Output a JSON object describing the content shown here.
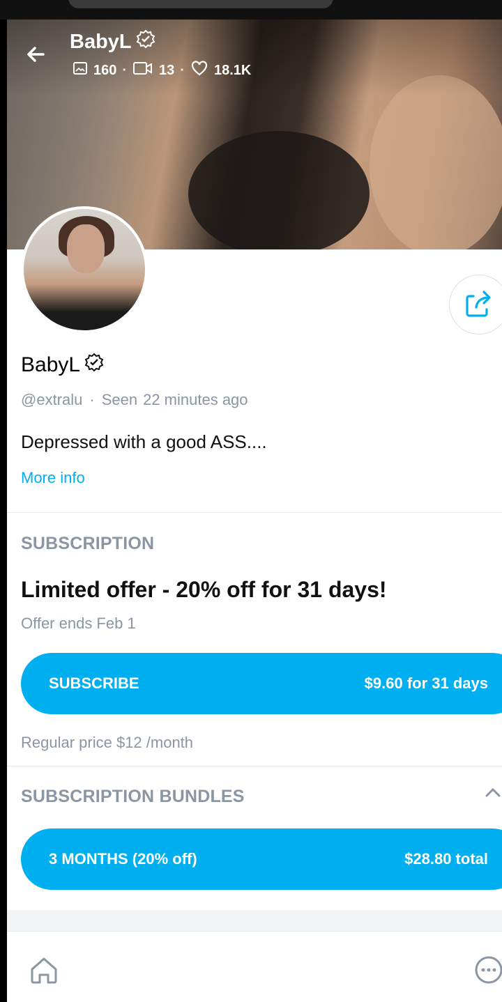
{
  "header": {
    "name": "BabyL",
    "stats": {
      "photos": "160",
      "videos": "13",
      "likes": "18.1K"
    },
    "separator": "·"
  },
  "profile": {
    "name": "BabyL",
    "handle": "@extralu",
    "separator": "·",
    "seen_label": "Seen",
    "seen_time": "22 minutes ago",
    "bio": "Depressed with a good ASS....",
    "more_info": "More info"
  },
  "subscription": {
    "section_title": "SUBSCRIPTION",
    "offer_title": "Limited offer - 20% off for 31 days!",
    "offer_ends": "Offer ends Feb 1",
    "button_label": "SUBSCRIBE",
    "button_price": "$9.60 for 31 days",
    "regular_price": "Regular price $12 /month"
  },
  "bundles": {
    "section_title": "SUBSCRIPTION BUNDLES",
    "items": [
      {
        "label": "3 MONTHS (20% off)",
        "price": "$28.80 total"
      }
    ]
  },
  "colors": {
    "accent": "#00aff0",
    "muted": "#8a96a3"
  },
  "icons": [
    "back-arrow-icon",
    "verified-badge-icon",
    "image-icon",
    "video-icon",
    "heart-icon",
    "share-icon",
    "chevron-up-icon",
    "home-icon",
    "more-icon"
  ]
}
